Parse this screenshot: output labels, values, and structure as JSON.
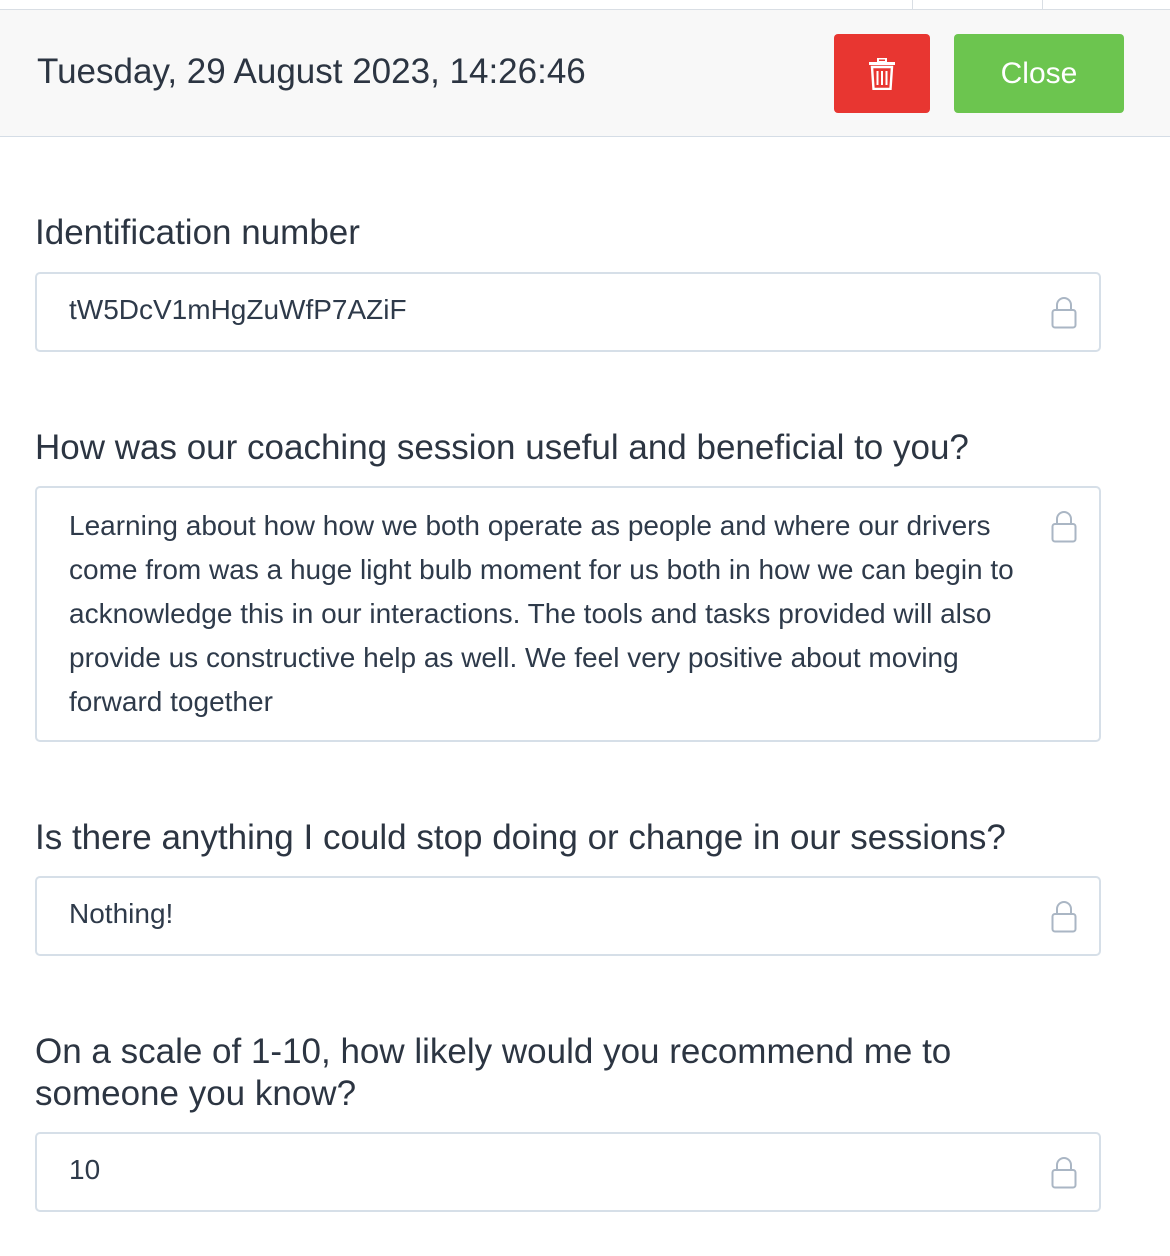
{
  "header": {
    "title": "Tuesday, 29 August 2023, 14:26:46",
    "close_label": "Close",
    "delete_icon": "trash-icon"
  },
  "fields": [
    {
      "label": "Identification number",
      "value": "tW5DcV1mHgZuWfP7AZiF"
    },
    {
      "label": "How was our coaching session useful and beneficial to you?",
      "value": "Learning about how how we both operate as people and where our drivers come from was a huge light bulb moment for us both in how we can begin to acknowledge this in our interactions. The tools and tasks provided will also provide us constructive help as well. We feel very positive about moving forward together"
    },
    {
      "label": "Is there anything I could stop doing or change in our sessions?",
      "value": "Nothing!"
    },
    {
      "label": "On a scale of 1-10, how likely would you recommend me to someone you know?",
      "value": "10"
    }
  ],
  "colors": {
    "delete": "#e83631",
    "close": "#6cc54f",
    "border": "#d6dfe8",
    "lock": "#aab6c4"
  }
}
